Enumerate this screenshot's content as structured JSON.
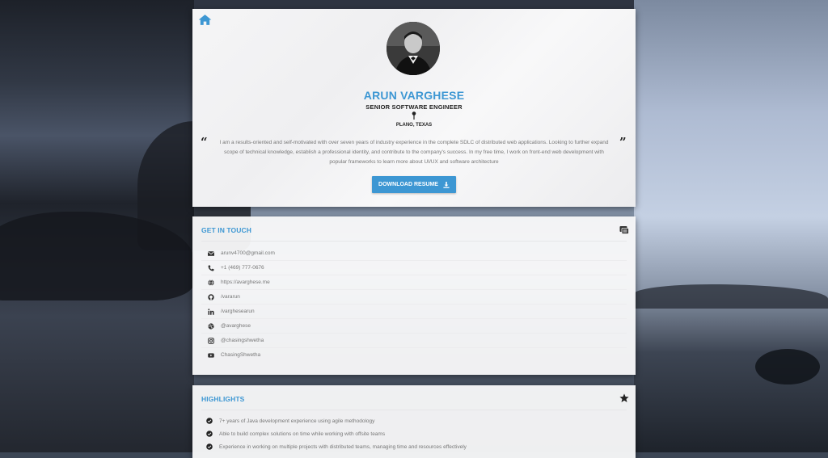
{
  "profile": {
    "name": "ARUN VARGHESE",
    "title": "SENIOR SOFTWARE ENGINEER",
    "location": "PLANO, TEXAS",
    "bio": "I am a results-oriented and self-motivated with over seven years of industry experience in the complete SDLC of distributed web applications. Looking to further expand scope of technical knowledge, establish a professional identity, and contribute to the company's success. In my free time, I work on front-end web development with popular frameworks to learn more about UI/UX and software architecture",
    "quote_open": "“",
    "quote_close": "”",
    "download_label": "DOWNLOAD RESUME"
  },
  "contact": {
    "title": "GET IN TOUCH",
    "items": [
      {
        "icon": "envelope-icon",
        "text": "arunv4700@gmail.com"
      },
      {
        "icon": "phone-icon",
        "text": "+1 (469) 777-0676"
      },
      {
        "icon": "globe-icon",
        "text": "https://avarghese.me"
      },
      {
        "icon": "github-icon",
        "text": "/vararun"
      },
      {
        "icon": "linkedin-icon",
        "text": "/varghesearun"
      },
      {
        "icon": "dribbble-icon",
        "text": "@avarghese"
      },
      {
        "icon": "instagram-icon",
        "text": "@chasingshwetha"
      },
      {
        "icon": "youtube-icon",
        "text": "ChasingShwetha"
      }
    ]
  },
  "highlights": {
    "title": "HIGHLIGHTS",
    "items": [
      "7+ years of Java development experience using agile methodology",
      "Able to build complex solutions on time while working with offsite teams",
      "Experience in working on multiple projects with distributed teams, managing time and resources effectively"
    ]
  },
  "colors": {
    "accent": "#3d97d3",
    "text_dark": "#222222",
    "text_muted": "#777777"
  }
}
